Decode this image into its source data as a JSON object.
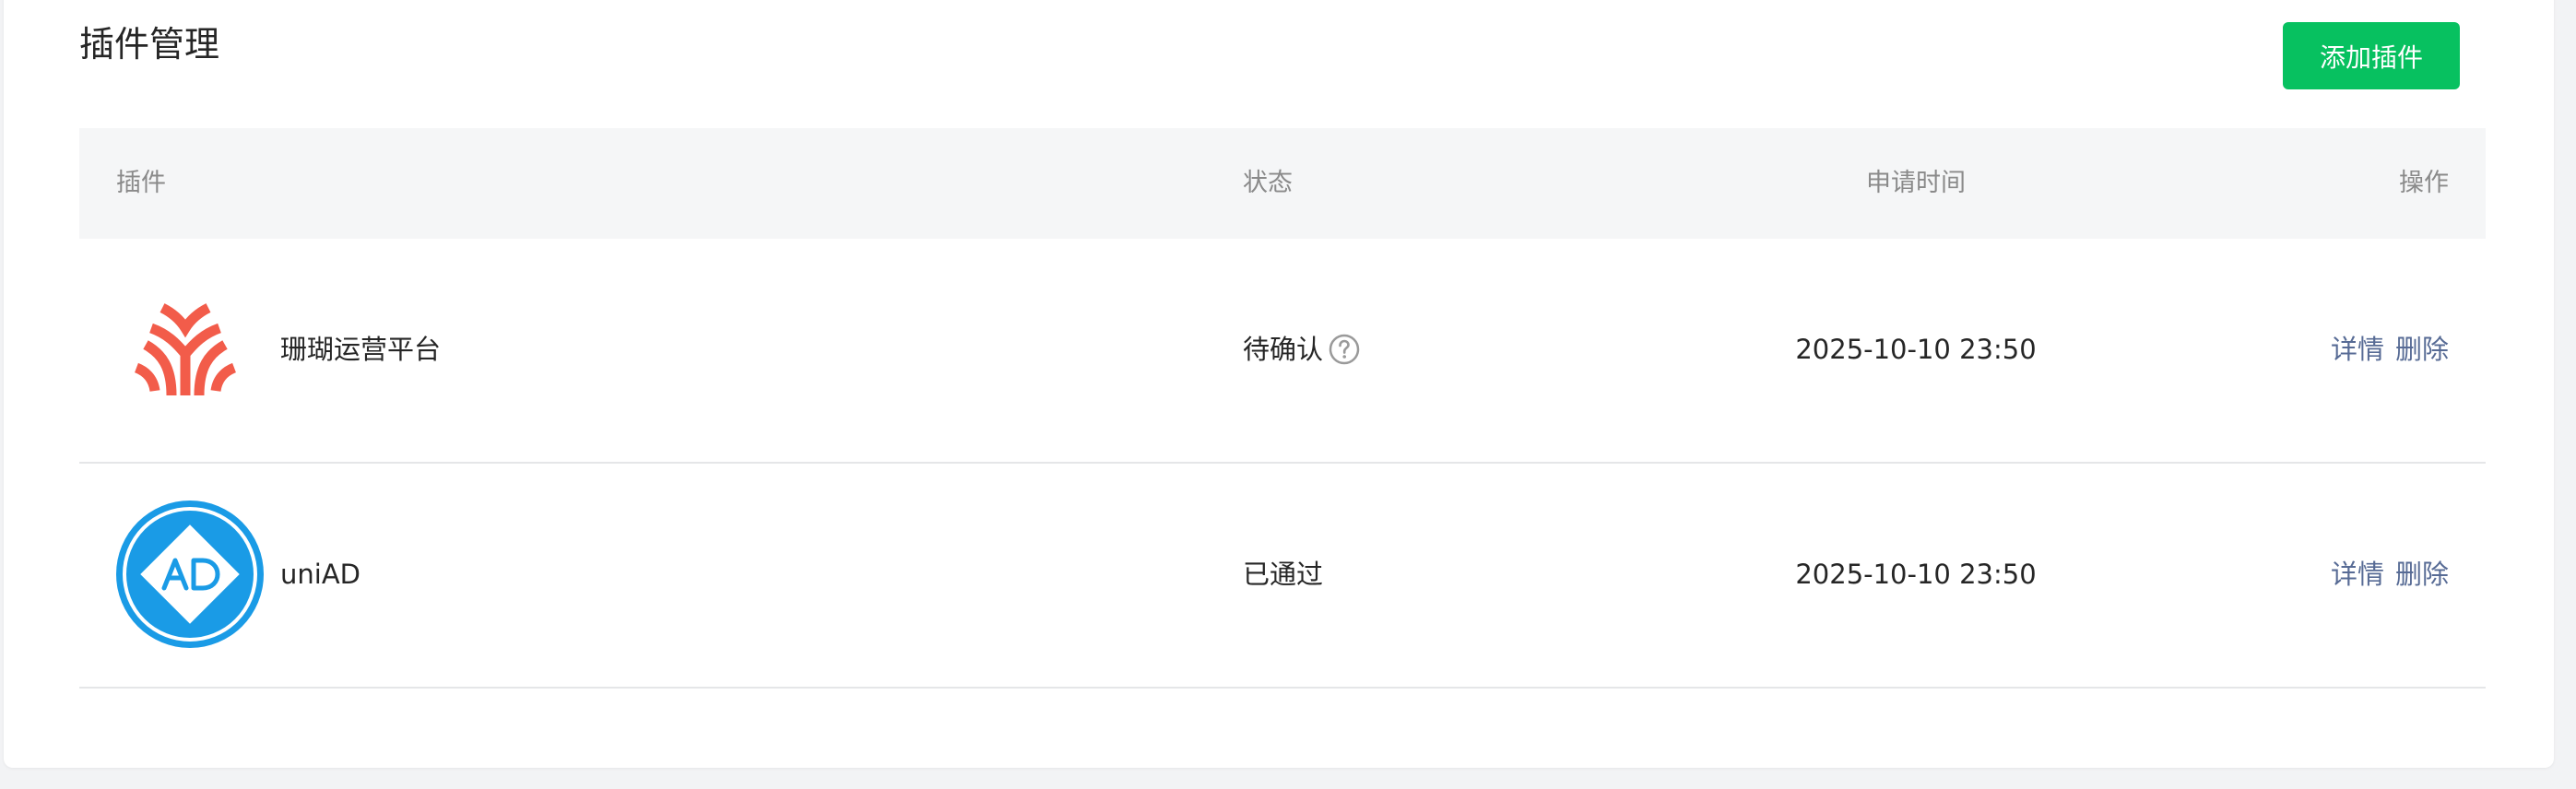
{
  "page": {
    "title": "插件管理",
    "add_button_label": "添加插件"
  },
  "table": {
    "headers": {
      "plugin": "插件",
      "status": "状态",
      "apply_time": "申请时间",
      "operations": "操作"
    },
    "rows": [
      {
        "name": "珊瑚运营平台",
        "logo_icon": "coral-logo-icon",
        "status": "待确认",
        "status_help_icon": "question-circle-icon",
        "apply_time": "2025-10-10 23:50",
        "detail_label": "详情",
        "delete_label": "删除"
      },
      {
        "name": "uniAD",
        "logo_icon": "uniad-logo-icon",
        "status": "已通过",
        "apply_time": "2025-10-10 23:50",
        "detail_label": "详情",
        "delete_label": "删除"
      }
    ]
  },
  "colors": {
    "primary_button": "#07c160",
    "link": "#576b95",
    "coral_logo": "#f25c4a",
    "uniad_logo": "#1a9be6"
  }
}
